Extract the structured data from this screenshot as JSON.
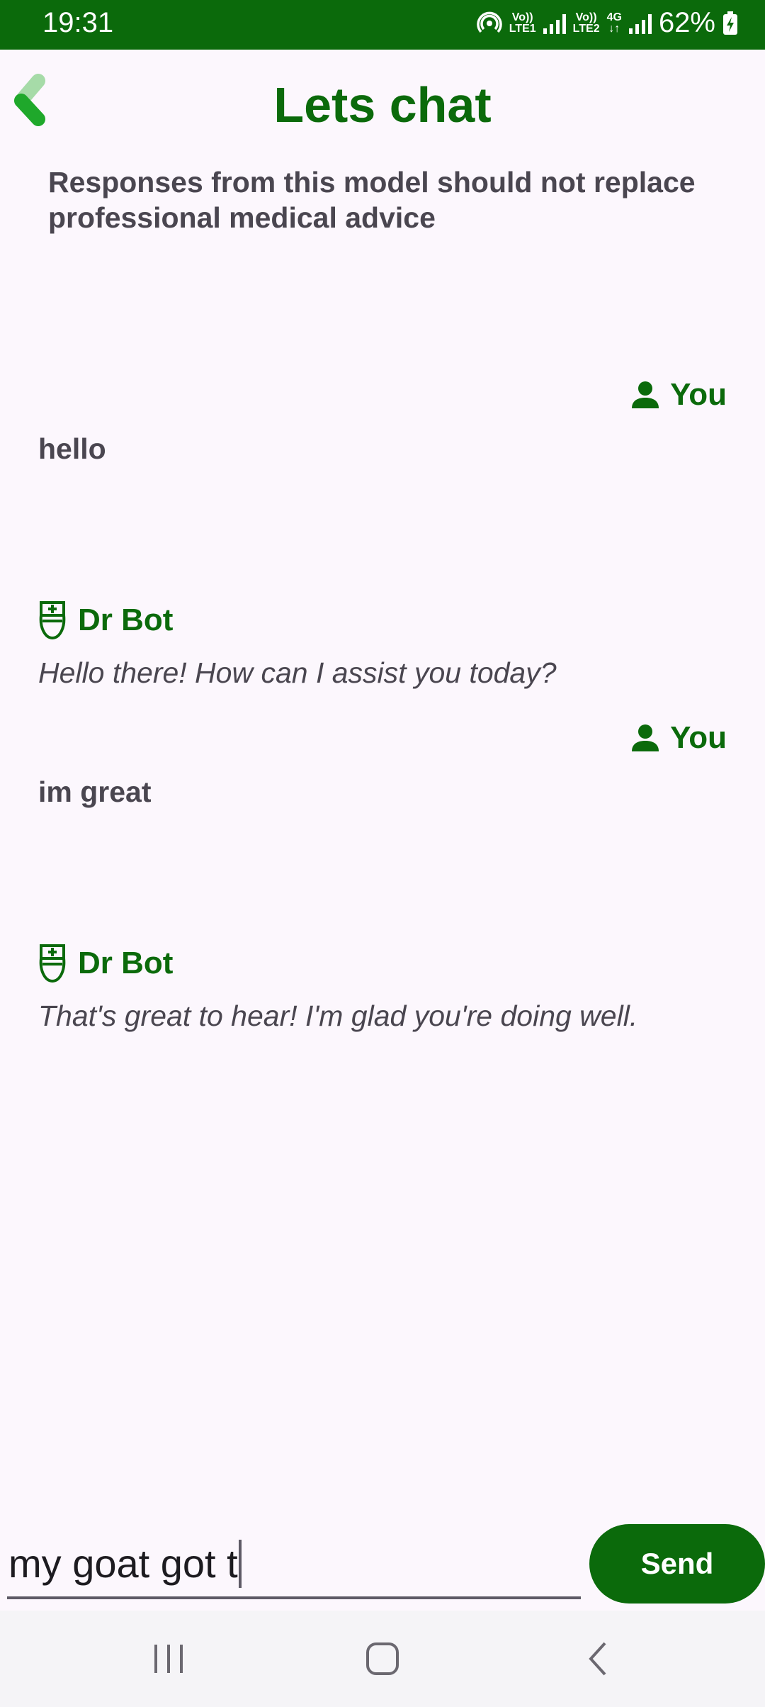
{
  "status_bar": {
    "time": "19:31",
    "network1_top": "Vo))",
    "network1_bottom": "LTE1",
    "network2_top": "Vo))",
    "network2_bottom": "LTE2",
    "network_type": "4G",
    "battery": "62%"
  },
  "header": {
    "title": "Lets chat",
    "disclaimer": "Responses from this model should not replace professional medical advice"
  },
  "messages": [
    {
      "sender": "You",
      "text": "hello"
    },
    {
      "sender": "Dr Bot",
      "text": "Hello there! How can I assist you today?"
    },
    {
      "sender": "You",
      "text": "im great"
    },
    {
      "sender": "Dr Bot",
      "text": "That's great to hear! I'm glad you're doing well."
    }
  ],
  "input": {
    "value": "my goat got t"
  },
  "send_button": {
    "label": "Send"
  },
  "colors": {
    "primary": "#0B6A0B",
    "background": "#FCF7FD",
    "text": "#4A4650"
  },
  "icons": {
    "back": "chevron-left-icon",
    "user": "person-icon",
    "bot": "nurse-icon",
    "nav_recents": "recents-icon",
    "nav_home": "home-icon",
    "nav_back": "back-icon"
  }
}
